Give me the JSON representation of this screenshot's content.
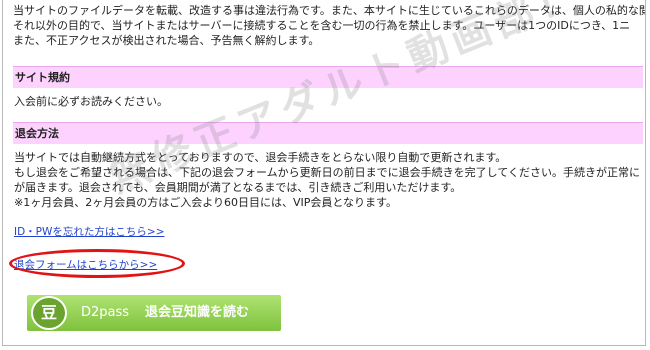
{
  "intro": {
    "lines": [
      "当サイトのファイルデータを転載、改造する事は違法行為です。また、本サイトに生じているこれらのデータは、個人の私的な閲",
      "それ以外の目的で、当サイトまたはサーバーに接続することを含む一切の行為を禁止します。ユーザーは1つのIDにつき、1ニ",
      "また、不正アクセスが検出された場合、予告無く解約します。"
    ]
  },
  "terms": {
    "heading": "サイト規約",
    "text": "入会前に必ずお読みください。"
  },
  "cancel": {
    "heading": "退会方法",
    "lines": [
      "当サイトでは自動継続方式をとっておりますので、退会手続きをとらない限り自動で更新されます。",
      "もし退会をご希望される場合は、下記の退会フォームから更新日の前日までに退会手続きを完了してください。手続きが正常に",
      "が届きます。退会されても、会員期間が満了となるまでは、引き続きご利用いただけます。",
      "※1ヶ月会員、2ヶ月会員の方はご入会より60日目には、VIP会員となります。"
    ]
  },
  "links": {
    "forgot": "ID・PWを忘れた方はこちら>>",
    "cancel_form": "退会フォームはこちらから>>"
  },
  "watermark": "無修正アダルト動画部！",
  "banner": {
    "icon_char": "豆",
    "brand": "D2pass",
    "label": "退会豆知識を読む"
  },
  "colors": {
    "section_bg": "#fdd2ff",
    "link": "#2244cc",
    "highlight": "#e01414",
    "banner_green": "#8ccd4a"
  }
}
